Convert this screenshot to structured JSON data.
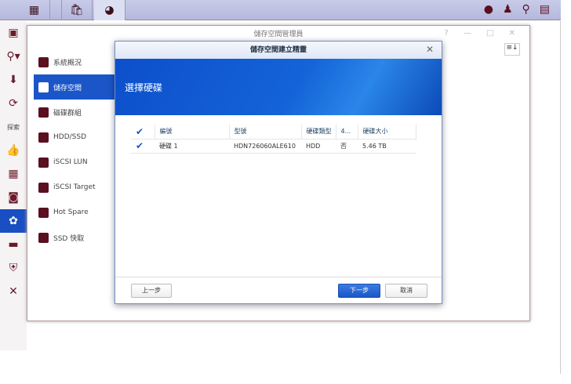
{
  "taskbar": {
    "icons": [
      "apps-grid-icon",
      "package-center-icon",
      "storage-manager-icon"
    ],
    "right_icons": [
      "chat-icon",
      "user-icon",
      "search-icon",
      "widgets-icon"
    ]
  },
  "dock": {
    "explore_label": "探索"
  },
  "window": {
    "title": "儲存空間管理員",
    "controls": "? — □ ✕"
  },
  "sidebar": {
    "items": [
      {
        "label": "系統概況"
      },
      {
        "label": "儲存空間"
      },
      {
        "label": "磁碟群組"
      },
      {
        "label": "HDD/SSD"
      },
      {
        "label": "iSCSI LUN"
      },
      {
        "label": "iSCSI Target"
      },
      {
        "label": "Hot Spare"
      },
      {
        "label": "SSD 快取"
      }
    ]
  },
  "dialog": {
    "title": "儲存空間建立精靈",
    "heading": "選擇硬碟",
    "columns": [
      "編號",
      "型號",
      "硬碟類型",
      "4...",
      "硬碟大小"
    ],
    "rows": [
      {
        "id": "硬碟 1",
        "model": "HDN726060ALE610",
        "type": "HDD",
        "col4": "否",
        "size": "5.46 TB",
        "checked": true
      }
    ],
    "back": "上一步",
    "next": "下一步",
    "cancel": "取消"
  }
}
